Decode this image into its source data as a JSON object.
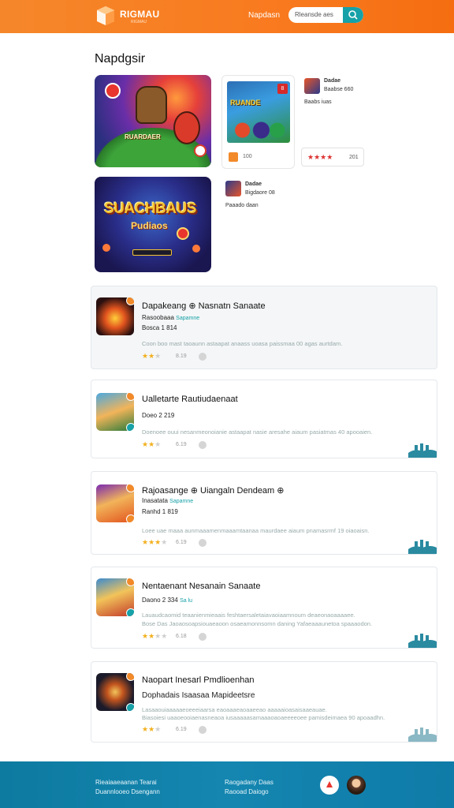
{
  "header": {
    "brand": "RIGMAU",
    "brand_sub": "RIGMAU",
    "nav_link": "Napdasn",
    "search_placeholder": "Rleansde aes"
  },
  "section_title": "Napdgsir",
  "featured": {
    "card1_label": "RUARDAER",
    "card2_title": "SUACHBAUS",
    "card2_sub": "Pudiaos",
    "mini_title": "RUANDE",
    "mini_badge": "8",
    "mini_foot": "100",
    "side1": {
      "title": "Dadae",
      "line1": "Baabse 660",
      "line2": "Baabs iuas"
    },
    "rating_stars": "★★★★",
    "rating_value": "201",
    "side2": {
      "title": "Dadae",
      "line1": "Bigdaore 08",
      "line2": "Paaado daan"
    }
  },
  "apps": [
    {
      "title": "Dapakeang ⊕ Nasnatn Sanaate",
      "line1": "Rasoobaaa",
      "tag": "Sapamne",
      "line2": "Bosca 1 814",
      "desc": "Coon boo mast taoaunn astaapat anaass uoasa paissmaa 00 agas aurtdam.",
      "desc2": "",
      "stars": "★★",
      "stars_off": "★",
      "rating": "8.19"
    },
    {
      "title": "Ualletarte Rautiudaenaat",
      "line1": "Doeo 2 219",
      "tag": "",
      "line2": "",
      "desc": "Doenoee ouui nesanmeonoianie astaapat nasie aresahe aiaum pasiatmas 40 apooaien.",
      "desc2": "",
      "stars": "★★",
      "stars_off": "★",
      "rating": "6.19"
    },
    {
      "title": "Rajoasange ⊕ Uiangaln Dendeam ⊕",
      "line1": "Inasatata",
      "tag": "Sapamne",
      "line2": "Ranhd 1 819",
      "desc": "Loee uae maaa aunmaaamenmaaamtaanaa maurdaee aiaum pnamasrmf 19 oiaoaisn.",
      "desc2": "",
      "stars": "★★★",
      "stars_off": "★",
      "rating": "6.19"
    },
    {
      "title": "Nentaenant Nesanain Sanaate",
      "line1": "Daono 2 334",
      "tag": "Sa lu",
      "line2": "",
      "desc": "Lauaudcaomid teaanienmieaais feshtaersaletaiavaoiaamnoum deaeonaoaaaaee.",
      "desc2": "Bose Das Jaoaosoapsiouaeaoon osaeamonnsomn daning Yafaeaaaunetoa spaaaodon.",
      "stars": "★★",
      "stars_off": "★★",
      "rating": "6.18"
    },
    {
      "title": "Naopart Inesarl Pmdlioenhan",
      "line1": "Dophadais Isaasaa Mapideetsre",
      "tag": "",
      "line2": "",
      "desc": "Lasaaouiaaaaaeoeeeiaarsa eaoaaaeaoaaeeao aaaaaioasaisaaeauae.",
      "desc2": "Biasoiesi uaaoeooiaenasneaoa iusaaaaasamaaaoaoaeeeeoee pamisdeimaea 90 apoaadhn.",
      "stars": "★★",
      "stars_off": "★",
      "rating": "6.19"
    }
  ],
  "footer": {
    "col1_line1": "Rieaiaaeaanan Tearai",
    "col1_line2": "Duannlooeo Dsengann",
    "col2_line1": "Raogadany Daas",
    "col2_line2": "Raooad Daiogo"
  },
  "colors": {
    "header_orange": "#f5872a",
    "accent_teal": "#17a1a8",
    "star_gold": "#f2b01e",
    "footer_blue": "#0d7aa0"
  }
}
